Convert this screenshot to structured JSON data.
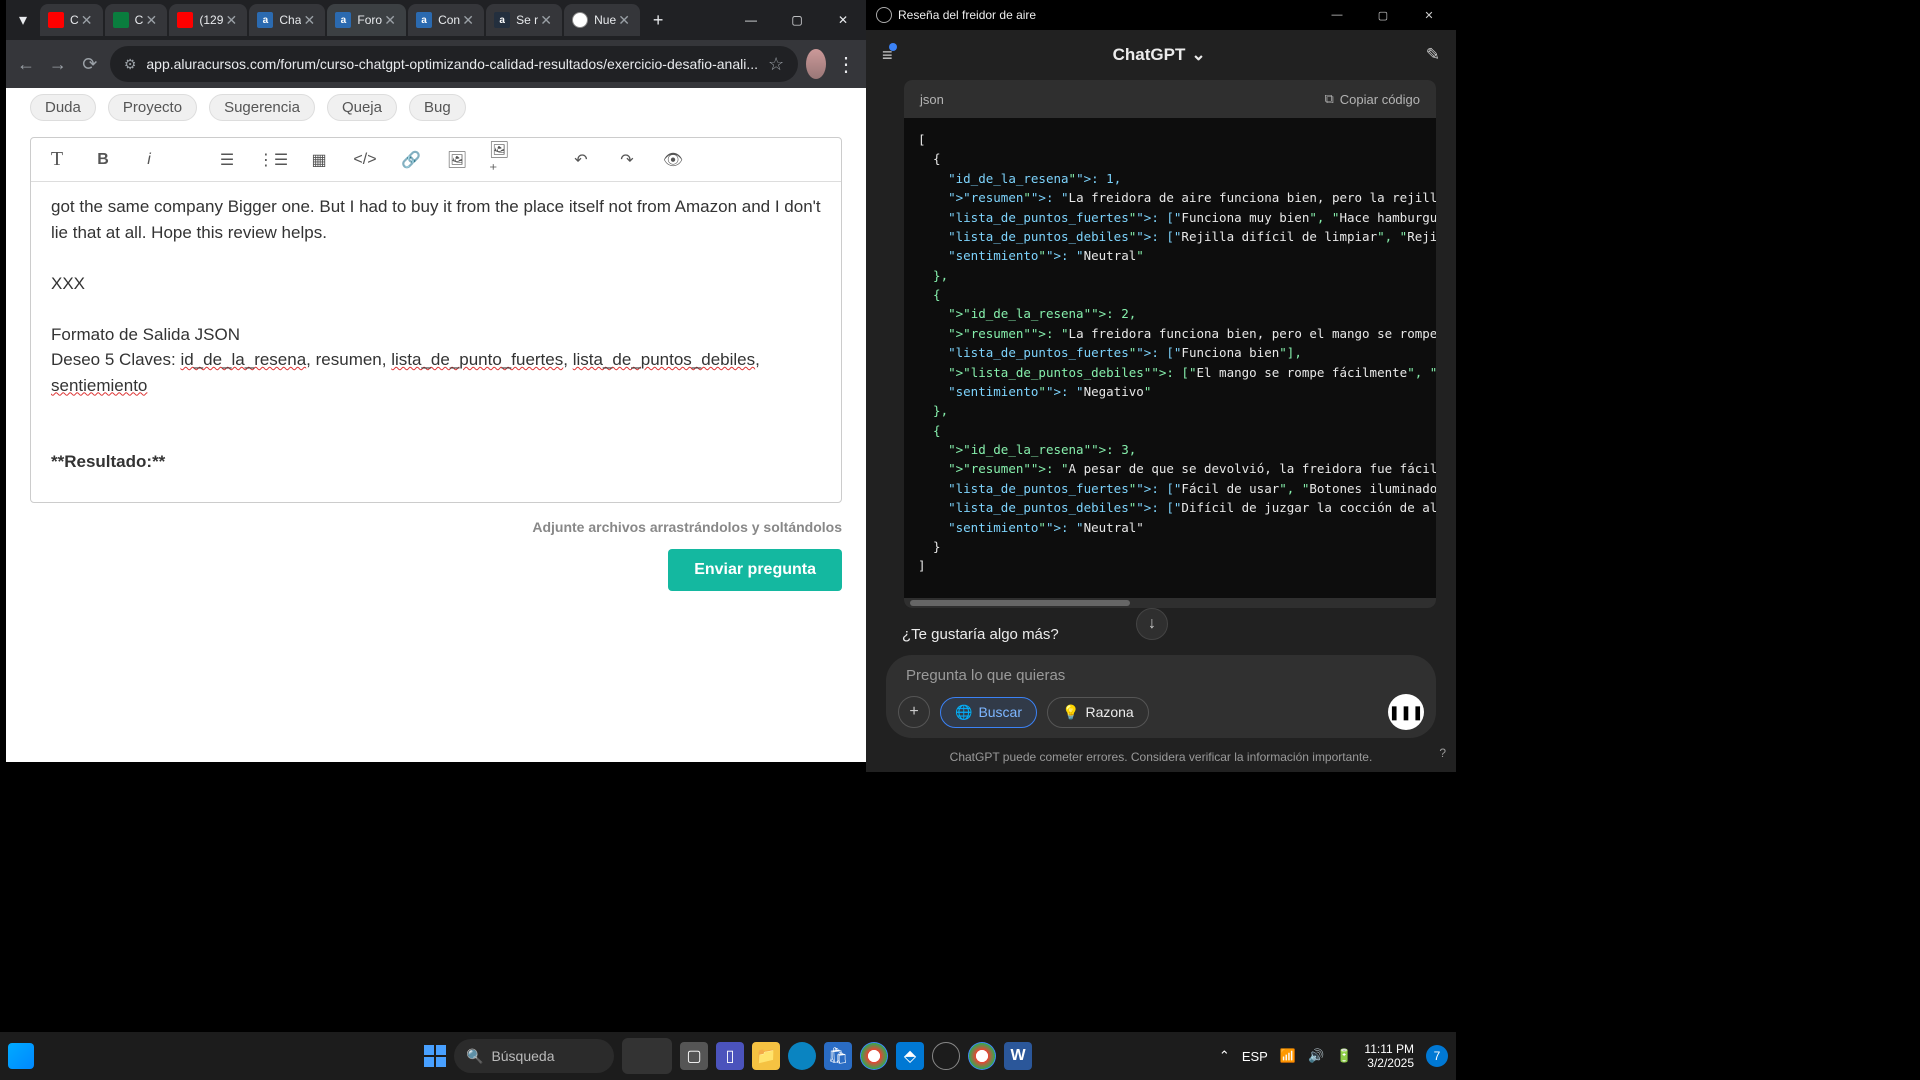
{
  "chrome": {
    "tabs": [
      {
        "title": "C",
        "fav": "yt"
      },
      {
        "title": "C",
        "fav": "green"
      },
      {
        "title": "(129",
        "fav": "yt"
      },
      {
        "title": "Cha",
        "fav": "a"
      },
      {
        "title": "Foro",
        "fav": "a",
        "active": true
      },
      {
        "title": "Con",
        "fav": "a"
      },
      {
        "title": "Se r",
        "fav": "az"
      },
      {
        "title": "Nue",
        "fav": "gpt"
      }
    ],
    "url": "app.aluracursos.com/forum/curso-chatgpt-optimizando-calidad-resultados/exercicio-desafio-anali...",
    "categories": [
      "Duda",
      "Proyecto",
      "Sugerencia",
      "Queja",
      "Bug"
    ],
    "editor": {
      "line1": "got the same company Bigger one. But I had to buy it from the place itself not from Amazon and I don't lie that at all. Hope this review helps.",
      "xxx": "XXX",
      "formato": "Formato de Salida JSON",
      "deseo_prefix": "Deseo 5 Claves: ",
      "k1": "id_de_la_resena",
      "sep1": ", resumen, ",
      "k2": "lista_de_punto_fuertes",
      "sep2": ", ",
      "k3": "lista_de_puntos_debiles",
      "sep3": ", ",
      "k4": "sentiemiento",
      "resultado": "**Resultado:**"
    },
    "attach_hint": "Adjunte archivos arrastrándolos y soltándolos",
    "submit": "Enviar pregunta"
  },
  "gpt": {
    "window_title": "Reseña del freidor de aire",
    "brand": "ChatGPT",
    "code_lang": "json",
    "copy_label": "Copiar código",
    "code_text": "[\n  {\n    \"id_de_la_resena\": 1,\n    \"resumen\": \"La freidora de aire funciona bien, pero la rejilla es difícil\n    \"lista_de_puntos_fuertes\": [\"Funciona muy bien\", \"Hace hamburguesas delic\n    \"lista_de_puntos_debiles\": [\"Rejilla difícil de limpiar\", \"Rejilla podría\n    \"sentimiento\": \"Neutral\"\n  },\n  {\n    \"id_de_la_resena\": 2,\n    \"resumen\": \"La freidora funciona bien, pero el mango se rompe debido a lo\n    \"lista_de_puntos_fuertes\": [\"Funciona bien\"],\n    \"lista_de_puntos_debiles\": [\"El mango se rompe fácilmente\", \"Pocos tornil\n    \"sentimiento\": \"Negativo\"\n  },\n  {\n    \"id_de_la_resena\": 3,\n    \"resumen\": \"A pesar de que se devolvió, la freidora fue fácil de usar y c\n    \"lista_de_puntos_fuertes\": [\"Fácil de usar\", \"Botones iluminados\", \"Cocin\n    \"lista_de_puntos_debiles\": [\"Difícil de juzgar la cocción de algunos alim\n    \"sentimiento\": \"Neutral\"\n  }\n]",
    "followup": "¿Te gustaría algo más?",
    "input_placeholder": "Pregunta lo que quieras",
    "chip_search": "Buscar",
    "chip_reason": "Razona",
    "footer": "ChatGPT puede cometer errores. Considera verificar la información importante."
  },
  "taskbar": {
    "search": "Búsqueda",
    "lang": "ESP",
    "time": "11:11 PM",
    "date": "3/2/2025",
    "notif": "7"
  }
}
